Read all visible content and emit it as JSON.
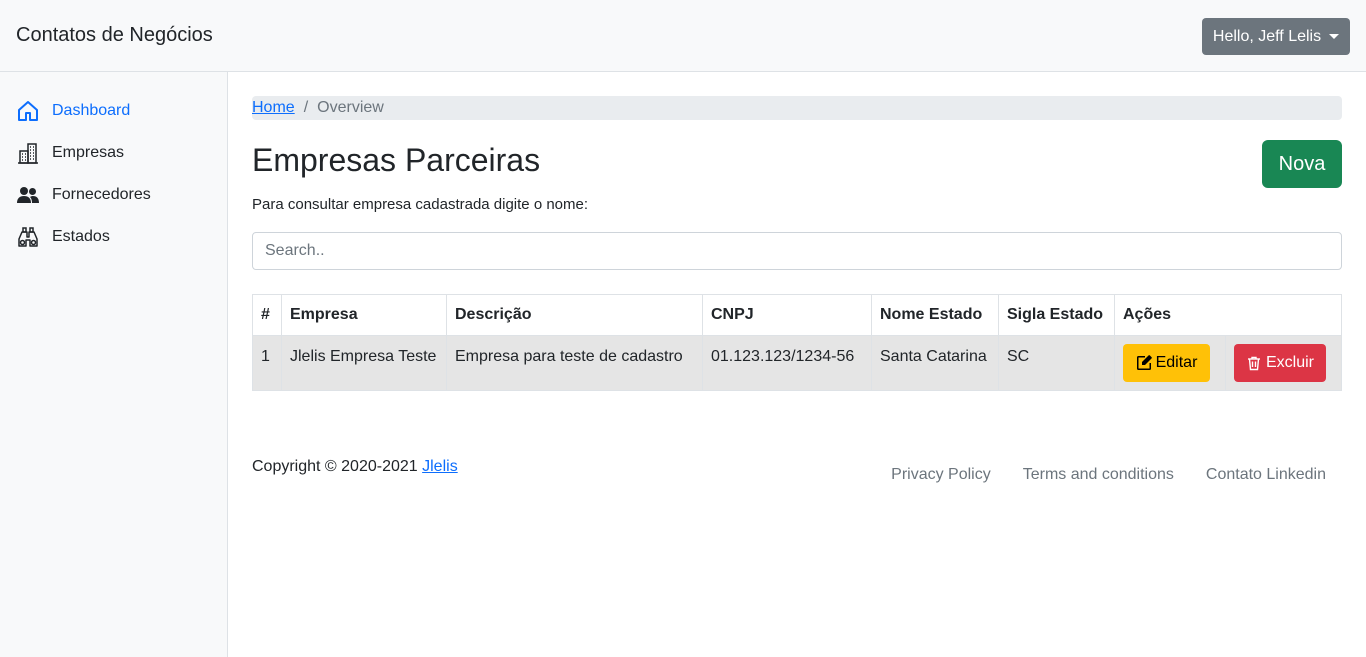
{
  "header": {
    "brand": "Contatos de Negócios",
    "user_button": "Hello, Jeff Lelis"
  },
  "sidebar": {
    "items": [
      {
        "label": "Dashboard",
        "icon": "house-icon"
      },
      {
        "label": "Empresas",
        "icon": "buildings-icon"
      },
      {
        "label": "Fornecedores",
        "icon": "people-icon"
      },
      {
        "label": "Estados",
        "icon": "binoculars-icon"
      }
    ]
  },
  "breadcrumb": {
    "home": "Home",
    "separator": "/",
    "current": "Overview"
  },
  "page": {
    "title": "Empresas Parceiras",
    "new_button": "Nova",
    "subtitle": "Para consultar empresa cadastrada digite o nome:",
    "search_placeholder": "Search.."
  },
  "table": {
    "headers": [
      "#",
      "Empresa",
      "Descrição",
      "CNPJ",
      "Nome Estado",
      "Sigla Estado",
      "Ações"
    ],
    "rows": [
      {
        "id": "1",
        "empresa": "Jlelis Empresa Teste",
        "descricao": "Empresa para teste de cadastro",
        "cnpj": "01.123.123/1234-56",
        "nome_estado": "Santa Catarina",
        "sigla": "SC",
        "edit": "Editar",
        "delete": "Excluir"
      }
    ]
  },
  "footer": {
    "copyright": "Copyright © 2020-2021",
    "author_link": "Jlelis",
    "links": [
      "Privacy Policy",
      "Terms and conditions",
      "Contato Linkedin"
    ]
  },
  "colors": {
    "primary": "#0d6efd",
    "success": "#198754",
    "warning": "#ffc107",
    "danger": "#dc3545",
    "secondary": "#6c757d"
  }
}
